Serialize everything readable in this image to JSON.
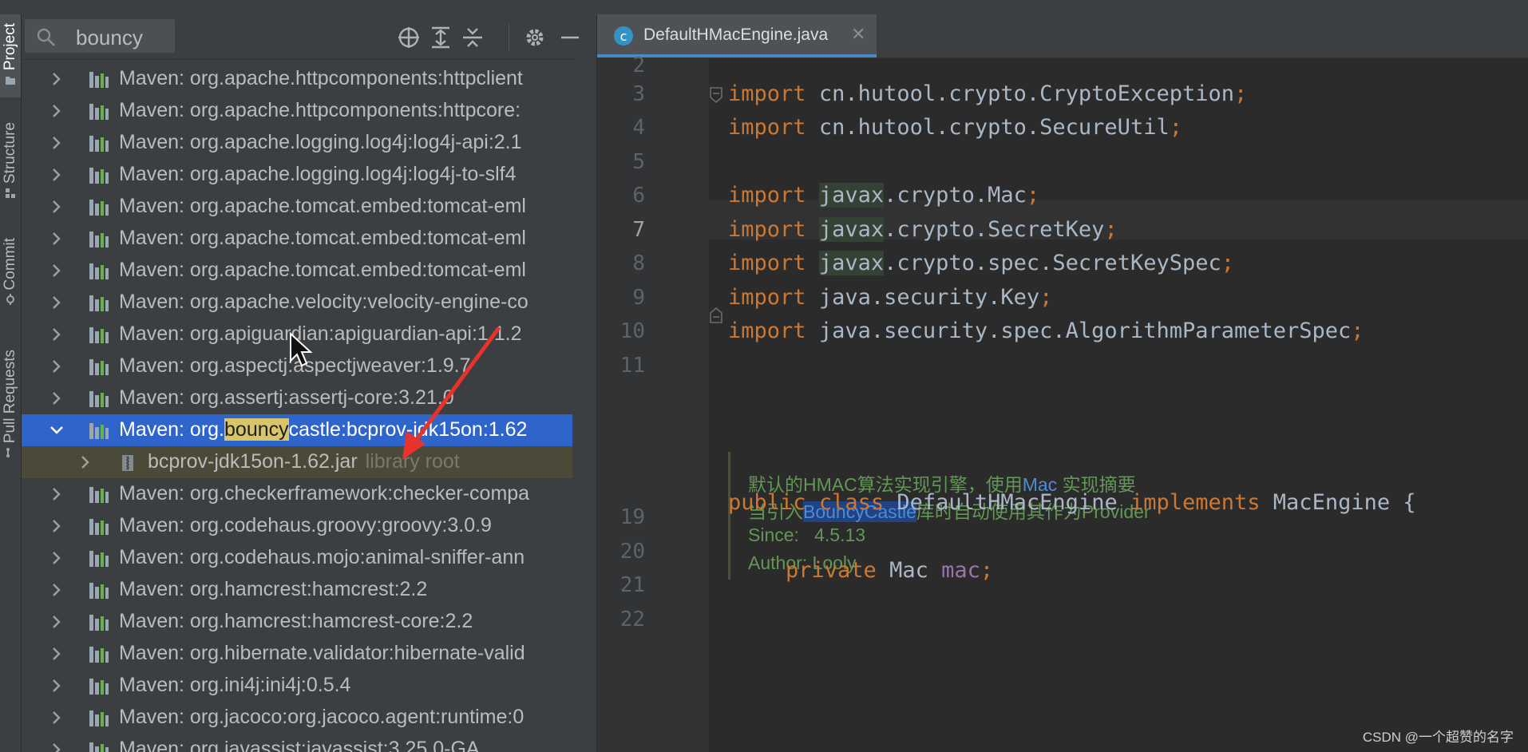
{
  "stripe": {
    "tabs": [
      "Project",
      "Structure",
      "Commit",
      "Pull Requests"
    ]
  },
  "project": {
    "search_value": "bouncy",
    "toolbar_icons": [
      "crosshair-icon",
      "expand-all-icon",
      "collapse-all-icon",
      "gear-icon",
      "minimize-icon"
    ],
    "rows": [
      {
        "label": "Maven: org.apache.httpcomponents:httpclient",
        "type": "collapsed"
      },
      {
        "label": "Maven: org.apache.httpcomponents:httpcore:",
        "type": "collapsed"
      },
      {
        "label": "Maven: org.apache.logging.log4j:log4j-api:2.1",
        "type": "collapsed"
      },
      {
        "label": "Maven: org.apache.logging.log4j:log4j-to-slf4",
        "type": "collapsed"
      },
      {
        "label": "Maven: org.apache.tomcat.embed:tomcat-eml",
        "type": "collapsed"
      },
      {
        "label": "Maven: org.apache.tomcat.embed:tomcat-eml",
        "type": "collapsed"
      },
      {
        "label": "Maven: org.apache.tomcat.embed:tomcat-eml",
        "type": "collapsed"
      },
      {
        "label": "Maven: org.apache.velocity:velocity-engine-co",
        "type": "collapsed"
      },
      {
        "label": "Maven: org.apiguardian:apiguardian-api:1.1.2",
        "type": "collapsed"
      },
      {
        "label": "Maven: org.aspectj:aspectjweaver:1.9.7",
        "type": "collapsed"
      },
      {
        "label": "Maven: org.assertj:assertj-core:3.21.0",
        "type": "collapsed"
      },
      {
        "label_pre": "Maven: org.",
        "label_hl": "bouncy",
        "label_post": "castle:bcprov-jdk15on:1.62",
        "type": "selected"
      },
      {
        "label": "bcprov-jdk15on-1.62.jar",
        "suffix": "library root",
        "type": "child"
      },
      {
        "label": "Maven: org.checkerframework:checker-compa",
        "type": "collapsed"
      },
      {
        "label": "Maven: org.codehaus.groovy:groovy:3.0.9",
        "type": "collapsed"
      },
      {
        "label": "Maven: org.codehaus.mojo:animal-sniffer-ann",
        "type": "collapsed"
      },
      {
        "label": "Maven: org.hamcrest:hamcrest:2.2",
        "type": "collapsed"
      },
      {
        "label": "Maven: org.hamcrest:hamcrest-core:2.2",
        "type": "collapsed"
      },
      {
        "label": "Maven: org.hibernate.validator:hibernate-valid",
        "type": "collapsed"
      },
      {
        "label": "Maven: org.ini4j:ini4j:0.5.4",
        "type": "collapsed"
      },
      {
        "label": "Maven: org.jacoco:org.jacoco.agent:runtime:0",
        "type": "collapsed"
      },
      {
        "label": "Maven: org.javassist:javassist:3.25.0-GA",
        "type": "collapsed"
      }
    ]
  },
  "editor": {
    "tab_label": "DefaultHMacEngine.java",
    "line_numbers": [
      "2",
      "3",
      "4",
      "5",
      "6",
      "7",
      "8",
      "9",
      "10",
      "11",
      "19",
      "20",
      "21",
      "22"
    ],
    "code": {
      "l3": {
        "kw": "import",
        "rest": "cn.hutool.crypto.CryptoException"
      },
      "l4": {
        "kw": "import",
        "rest": "cn.hutool.crypto.SecureUtil"
      },
      "l6": {
        "kw": "import",
        "pkg": "javax",
        "rest": ".crypto.Mac"
      },
      "l7": {
        "kw": "import",
        "pkg": "javax",
        "rest": ".crypto.SecretKey"
      },
      "l8": {
        "kw": "import",
        "pkg": "javax",
        "rest": ".crypto.spec.SecretKeySpec"
      },
      "l9": {
        "kw": "import",
        "rest": "java.security.Key"
      },
      "l10": {
        "kw": "import",
        "rest": "java.security.spec.AlgorithmParameterSpec"
      },
      "l19": {
        "kw1": "public",
        "kw2": "class",
        "name": "DefaultHMacEngine",
        "kw3": "implements",
        "iface": "MacEngine",
        "brace": "{"
      },
      "l21": {
        "kw": "private",
        "type": "Mac",
        "field": "mac"
      },
      "semicolon": ";"
    },
    "doc": {
      "line1_pre": "默认的HMAC算法实现引擎，使用",
      "line1_link": "Mac",
      "line1_post": " 实现摘要",
      "line2_pre": "当引入",
      "line2_sel": "BouncyCastle",
      "line2_post": "库时自动使用其作为Provider",
      "since_label": "Since:",
      "since_value": "4.5.13",
      "author": "Author: Looly"
    }
  },
  "watermark": "CSDN @一个超赞的名字",
  "colors": {
    "selection": "#2f65ca",
    "keyword": "#cc7832",
    "doc_comment": "#629755",
    "annotation_arrow": "#e8322c"
  }
}
